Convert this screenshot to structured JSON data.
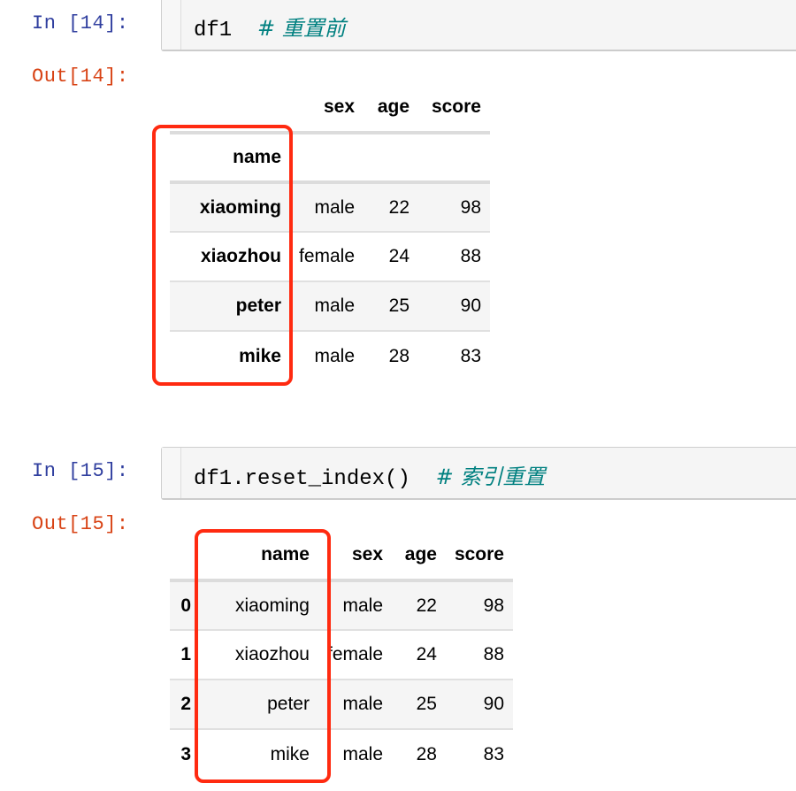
{
  "cells": [
    {
      "in_prompt": "In [14]:",
      "code": "df1  ",
      "comment": "# 重置前",
      "out_prompt": "Out[14]:",
      "table": {
        "columns": [
          "sex",
          "age",
          "score"
        ],
        "index_name": "name",
        "rows": [
          {
            "index": "xiaoming",
            "values": [
              "male",
              "22",
              "98"
            ]
          },
          {
            "index": "xiaozhou",
            "values": [
              "female",
              "24",
              "88"
            ]
          },
          {
            "index": "peter",
            "values": [
              "male",
              "25",
              "90"
            ]
          },
          {
            "index": "mike",
            "values": [
              "male",
              "28",
              "83"
            ]
          }
        ]
      }
    },
    {
      "in_prompt": "In [15]:",
      "code": "df1.reset_index()  ",
      "comment": "# 索引重置",
      "out_prompt": "Out[15]:",
      "table": {
        "columns": [
          "name",
          "sex",
          "age",
          "score"
        ],
        "rows": [
          {
            "index": "0",
            "values": [
              "xiaoming",
              "male",
              "22",
              "98"
            ]
          },
          {
            "index": "1",
            "values": [
              "xiaozhou",
              "female",
              "24",
              "88"
            ]
          },
          {
            "index": "2",
            "values": [
              "peter",
              "male",
              "25",
              "90"
            ]
          },
          {
            "index": "3",
            "values": [
              "mike",
              "male",
              "28",
              "83"
            ]
          }
        ]
      }
    }
  ],
  "highlight_color": "#ff2a10"
}
